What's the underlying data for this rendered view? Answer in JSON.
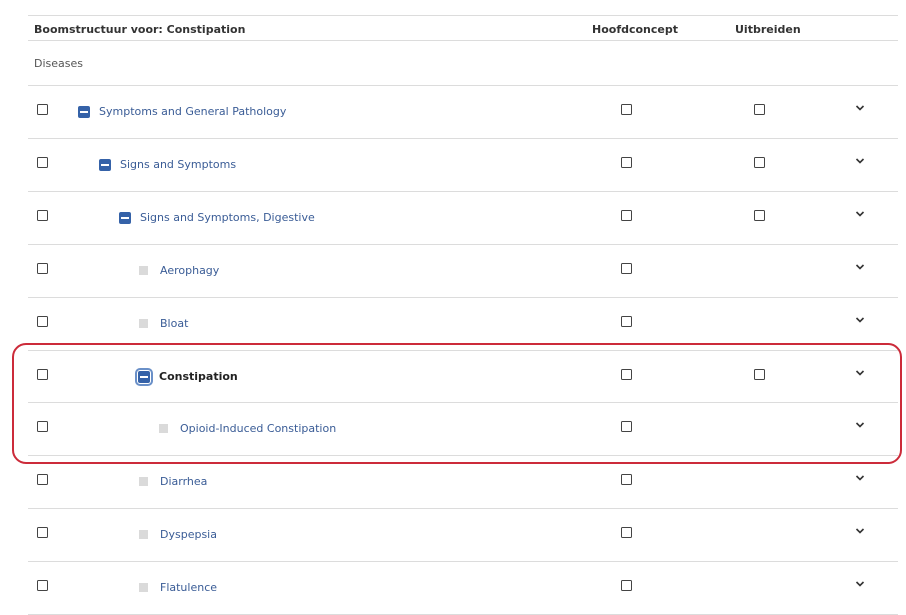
{
  "header": {
    "title": "Boomstructuur voor: Constipation",
    "col_main": "Hoofdconcept",
    "col_expand": "Uitbreiden"
  },
  "root": {
    "label": "Diseases"
  },
  "rows": [
    {
      "label": "Symptoms and General Pathology",
      "toggle": "collapse"
    },
    {
      "label": "Signs and Symptoms",
      "toggle": "collapse"
    },
    {
      "label": "Signs and Symptoms, Digestive",
      "toggle": "collapse"
    },
    {
      "label": "Aerophagy",
      "toggle": "leaf"
    },
    {
      "label": "Bloat",
      "toggle": "leaf"
    },
    {
      "label": "Constipation",
      "toggle": "collapse",
      "selected": true
    },
    {
      "label": "Opioid-Induced Constipation",
      "toggle": "leaf"
    },
    {
      "label": "Diarrhea",
      "toggle": "leaf"
    },
    {
      "label": "Dyspepsia",
      "toggle": "leaf"
    },
    {
      "label": "Flatulence",
      "toggle": "leaf"
    }
  ],
  "colors": {
    "accent": "#3562a8",
    "link": "#3a5c96",
    "highlight_border": "#cc2b3a"
  }
}
